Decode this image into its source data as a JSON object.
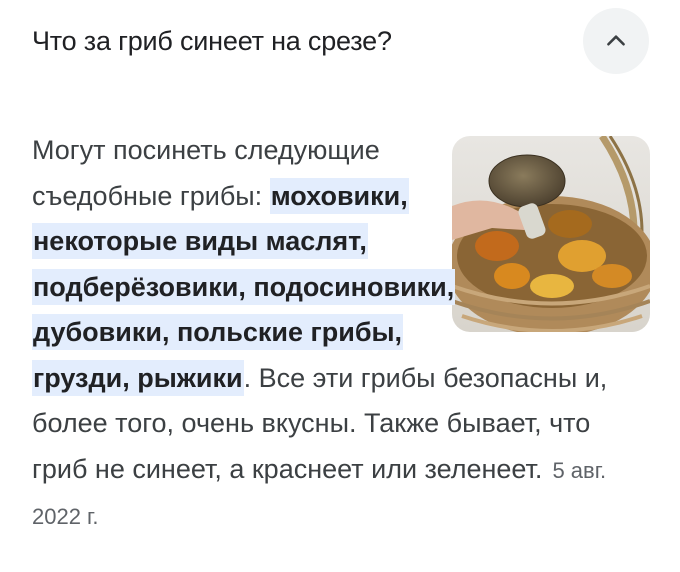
{
  "question": {
    "text": "Что за гриб синеет на срезе?",
    "toggle_icon": "chevron-up-icon",
    "toggle_bg": "#f1f3f4"
  },
  "answer": {
    "intro": "Могут посинеть следующие съедобные грибы: ",
    "highlight": "моховики, некоторые виды маслят, подберёзовики, подосиновики, дубовики, польские грибы, грузди, рыжики",
    "rest": ". Все эти грибы безопасны и, более того, очень вкусны. Также бывает, что гриб не синеет, а краснеет или зеленеет.",
    "date": "5 авг. 2022 г.",
    "highlight_color": "#e3edfd"
  },
  "image": {
    "subject": "mushroom-basket-photo"
  }
}
